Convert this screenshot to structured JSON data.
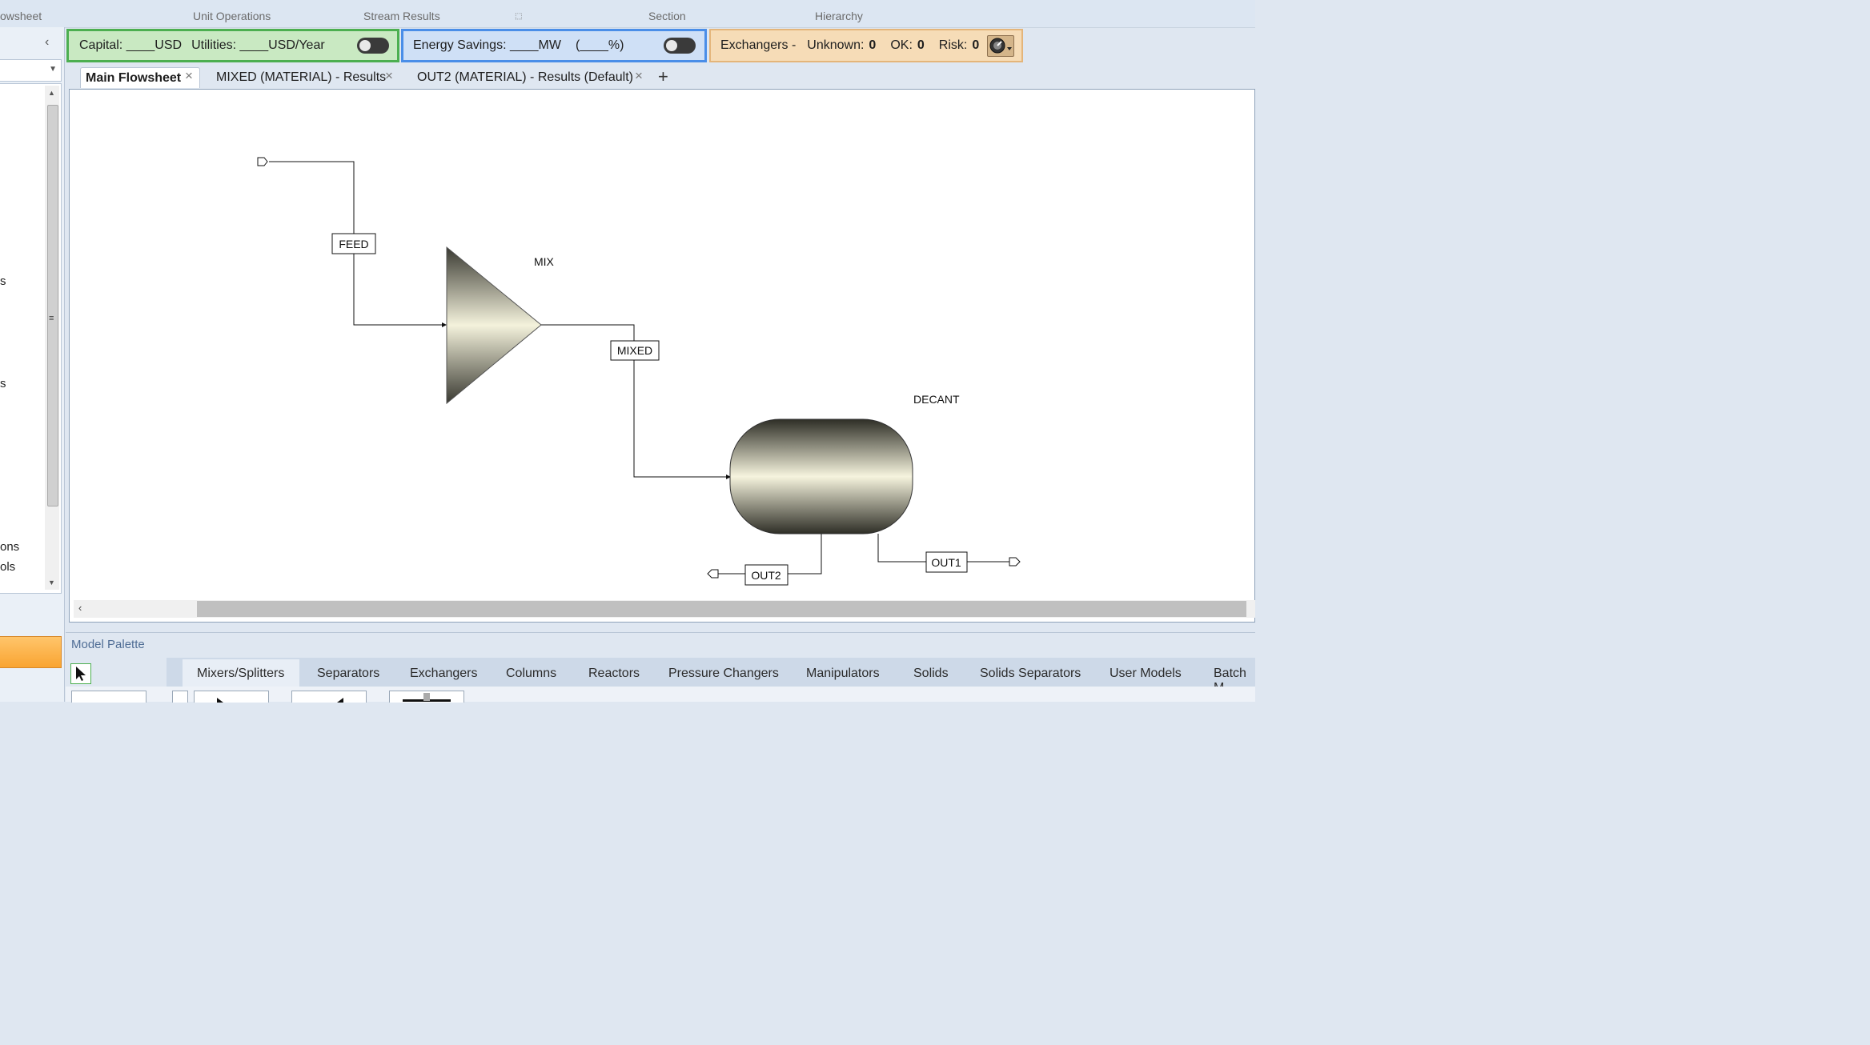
{
  "ribbon": {
    "groups": [
      "owsheet",
      "Unit Operations",
      "Stream Results",
      "Section",
      "Hierarchy"
    ]
  },
  "left_pane": {
    "tree_fragments": [
      "s",
      "s",
      "ons",
      "ols"
    ]
  },
  "kpi": {
    "capital_label": "Capital: ____USD",
    "utilities_label": "Utilities: ____USD/Year",
    "energy_label": "Energy Savings: ____MW",
    "energy_percent": "(____%)",
    "exchangers_label": "Exchangers -",
    "unknown_label": "Unknown:",
    "unknown_value": "0",
    "ok_label": "OK:",
    "ok_value": "0",
    "risk_label": "Risk:",
    "risk_value": "0"
  },
  "tabs": [
    {
      "label": "Main Flowsheet",
      "active": true
    },
    {
      "label": "MIXED (MATERIAL) - Results",
      "active": false
    },
    {
      "label": "OUT2 (MATERIAL) - Results (Default)",
      "active": false
    }
  ],
  "flowsheet": {
    "blocks": {
      "mixer": "MIX",
      "decanter": "DECANT"
    },
    "streams": {
      "feed": "FEED",
      "mixed": "MIXED",
      "out1": "OUT1",
      "out2": "OUT2"
    }
  },
  "palette": {
    "title": "Model Palette",
    "tabs": [
      "Mixers/Splitters",
      "Separators",
      "Exchangers",
      "Columns",
      "Reactors",
      "Pressure Changers",
      "Manipulators",
      "Solids",
      "Solids Separators",
      "User Models",
      "Batch M"
    ],
    "active_tab": "Mixers/Splitters"
  },
  "colors": {
    "capital_bg": "#c9e9c2",
    "capital_border": "#4caf50",
    "energy_bg": "#cfe0f6",
    "energy_border": "#4a8ee8",
    "exchangers_bg": "#f6dcb7"
  }
}
